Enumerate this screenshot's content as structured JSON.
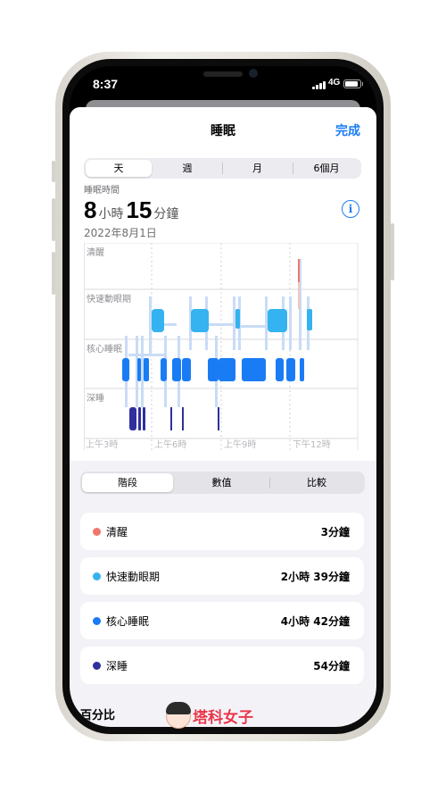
{
  "status": {
    "time": "8:37",
    "network": "4G"
  },
  "header": {
    "title": "睡眠",
    "done_label": "完成"
  },
  "range_tabs": [
    "天",
    "週",
    "月",
    "6個月"
  ],
  "summary": {
    "label": "睡眠時間",
    "hours": "8",
    "hours_unit": "小時",
    "minutes": "15",
    "minutes_unit": "分鐘",
    "date": "2022年8月1日"
  },
  "chart_data": {
    "type": "sleep-stage-timeline",
    "stages": [
      "清醒",
      "快速動眼期",
      "核心睡眠",
      "深睡"
    ],
    "x_ticks": [
      "上午3時",
      "上午6時",
      "上午9時",
      "下午12時"
    ],
    "colors": {
      "awake": "#f0776b",
      "rem": "#35b2f0",
      "core": "#1a7cf5",
      "deep": "#2f2f9e"
    }
  },
  "view_tabs": [
    "階段",
    "數值",
    "比較"
  ],
  "stage_list": [
    {
      "name": "清醒",
      "value": "3分鐘",
      "color": "#f0776b"
    },
    {
      "name": "快速動眼期",
      "value": "2小時 39分鐘",
      "color": "#35b2f0"
    },
    {
      "name": "核心睡眠",
      "value": "4小時 42分鐘",
      "color": "#1a7cf5"
    },
    {
      "name": "深睡",
      "value": "54分鐘",
      "color": "#2f2f9e"
    }
  ],
  "footer": {
    "section_title": "百分比"
  },
  "watermark": {
    "text": "塔科女子"
  }
}
